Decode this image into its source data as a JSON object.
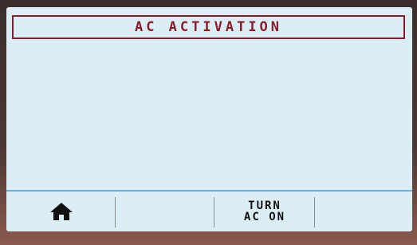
{
  "screen": {
    "title": "AC ACTIVATION"
  },
  "softkeys": {
    "home": {
      "icon": "home-icon"
    },
    "key2": {
      "label": ""
    },
    "key3": {
      "line1": "TURN",
      "line2": "AC ON"
    },
    "key4": {
      "label": ""
    }
  },
  "colors": {
    "title": "#8b1d2a",
    "screen_bg": "#dbeef5",
    "divider": "#6fb3d6"
  }
}
